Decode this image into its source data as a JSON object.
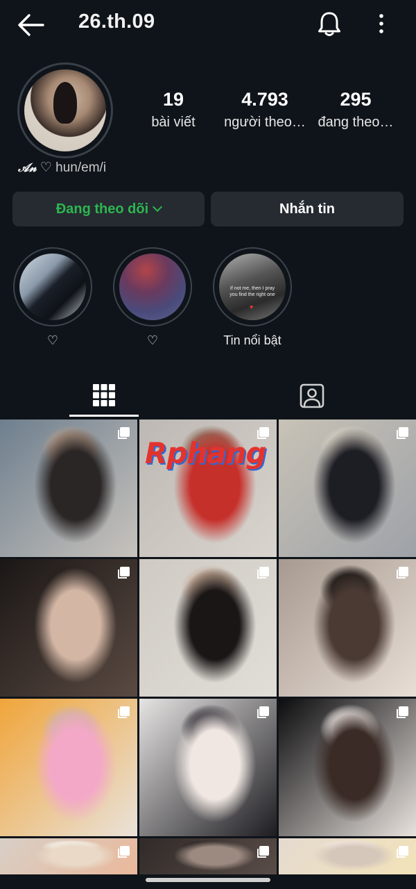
{
  "header": {
    "username": "26.th.09",
    "icons": {
      "back": "arrow-left-icon",
      "notifications": "bell-icon",
      "more": "more-vertical-icon"
    }
  },
  "profile": {
    "bio_name": "𝒜𝓃",
    "bio_heart": "♡",
    "bio_pronouns": "hun/em/i",
    "stats": [
      {
        "value": "19",
        "label": "bài viết"
      },
      {
        "value": "4.793",
        "label": "người theo…"
      },
      {
        "value": "295",
        "label": "đang theo…"
      }
    ]
  },
  "actions": {
    "following_label": "Đang theo dõi",
    "message_label": "Nhắn tin",
    "following_color": "#2db64f"
  },
  "highlights": [
    {
      "label": "♡"
    },
    {
      "label": "♡"
    },
    {
      "label": "Tin nổi bật",
      "caption": "If not me, then I pray you find the right one",
      "caption_heart": "♥"
    }
  ],
  "tabs": {
    "posts_icon": "grid-icon",
    "tagged_icon": "tagged-person-icon"
  },
  "posts": {
    "watermark": "Rphang",
    "multi_icon": "carousel-multiple-icon",
    "items": [
      {
        "colors": [
          "#6e7f8e",
          "#c8c3bd",
          "#2b2626",
          "#b39a88"
        ]
      },
      {
        "colors": [
          "#bdb8b3",
          "#d9d4ce",
          "#c6302b",
          "#8e6b5a"
        ]
      },
      {
        "colors": [
          "#c8c2b6",
          "#9ea2a8",
          "#1d1d24",
          "#d9d2c4"
        ]
      },
      {
        "colors": [
          "#1b1716",
          "#5a4a42",
          "#d3b6a4",
          "#241d1b"
        ]
      },
      {
        "colors": [
          "#cfcac4",
          "#e1ddd7",
          "#1a1616",
          "#c7ab97"
        ]
      },
      {
        "colors": [
          "#a79a90",
          "#e8ded6",
          "#4a3a33",
          "#1f1a18"
        ]
      },
      {
        "colors": [
          "#f0a53a",
          "#e9e2da",
          "#f3a8c8",
          "#d2b39e"
        ]
      },
      {
        "colors": [
          "#e6e4e3",
          "#1d1c20",
          "#f0e7e2",
          "#2a2830"
        ]
      },
      {
        "colors": [
          "#0c0c0e",
          "#e8e2dd",
          "#3a2b26",
          "#f2ecea"
        ]
      },
      {
        "colors": [
          "#d8cfc7",
          "#eab89a",
          "#e9d9c6",
          "#f3efe9"
        ]
      },
      {
        "colors": [
          "#302a28",
          "#5a4d48",
          "#9c8a80",
          "#2a2523"
        ]
      },
      {
        "colors": [
          "#e5dad0",
          "#f2e3b8",
          "#d6c7bb",
          "#efe6df"
        ]
      }
    ]
  }
}
